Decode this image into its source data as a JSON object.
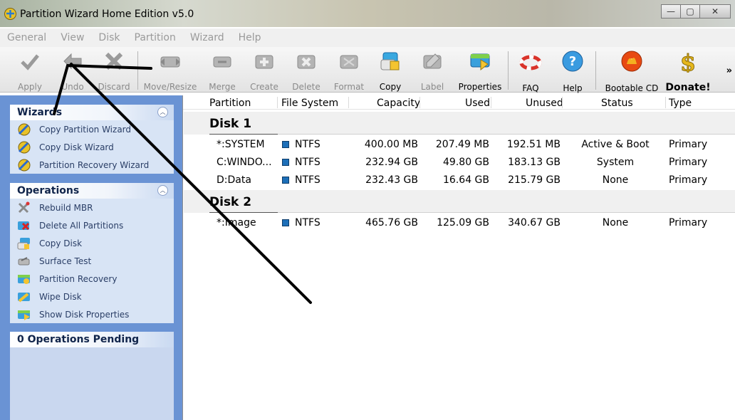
{
  "window": {
    "title": "Partition Wizard Home Edition v5.0",
    "minimize": "—",
    "maximize": "▢",
    "close": "✕"
  },
  "menu": [
    "General",
    "View",
    "Disk",
    "Partition",
    "Wizard",
    "Help"
  ],
  "toolbar": {
    "buttons": [
      {
        "label": "Apply",
        "icon": "check-icon",
        "enabled": false
      },
      {
        "label": "Undo",
        "icon": "undo-arrow-icon",
        "enabled": false
      },
      {
        "label": "Discard",
        "icon": "x-discard-icon",
        "enabled": false
      },
      {
        "label": "Move/Resize",
        "icon": "move-resize-icon",
        "enabled": false
      },
      {
        "label": "Merge",
        "icon": "merge-icon",
        "enabled": false
      },
      {
        "label": "Create",
        "icon": "create-icon",
        "enabled": false
      },
      {
        "label": "Delete",
        "icon": "delete-icon",
        "enabled": false
      },
      {
        "label": "Format",
        "icon": "format-icon",
        "enabled": false
      },
      {
        "label": "Copy",
        "icon": "copy-icon",
        "enabled": true
      },
      {
        "label": "Label",
        "icon": "label-icon",
        "enabled": false
      },
      {
        "label": "Properties",
        "icon": "properties-icon",
        "enabled": true
      },
      {
        "label": "FAQ",
        "icon": "lifebuoy-icon",
        "enabled": true
      },
      {
        "label": "Help",
        "icon": "help-icon",
        "enabled": true
      },
      {
        "label": "Bootable CD",
        "icon": "bootable-cd-icon",
        "enabled": true
      },
      {
        "label": "Donate!",
        "icon": "dollar-icon",
        "enabled": true
      }
    ],
    "more": "»"
  },
  "sidebar": {
    "wizards": {
      "title": "Wizards",
      "items": [
        "Copy Partition Wizard",
        "Copy Disk Wizard",
        "Partition Recovery Wizard"
      ]
    },
    "operations": {
      "title": "Operations",
      "items": [
        "Rebuild MBR",
        "Delete All Partitions",
        "Copy Disk",
        "Surface Test",
        "Partition Recovery",
        "Wipe Disk",
        "Show Disk Properties"
      ]
    },
    "pending": {
      "title": "0 Operations Pending"
    }
  },
  "table": {
    "columns": [
      "Partition",
      "File System",
      "Capacity",
      "Used",
      "Unused",
      "Status",
      "Type"
    ],
    "disks": [
      {
        "name": "Disk 1",
        "rows": [
          [
            "*:SYSTEM",
            "NTFS",
            "400.00 MB",
            "207.49 MB",
            "192.51 MB",
            "Active & Boot",
            "Primary"
          ],
          [
            "C:WINDO...",
            "NTFS",
            "232.94 GB",
            "49.80 GB",
            "183.13 GB",
            "System",
            "Primary"
          ],
          [
            "D:Data",
            "NTFS",
            "232.43 GB",
            "16.64 GB",
            "215.79 GB",
            "None",
            "Primary"
          ]
        ]
      },
      {
        "name": "Disk 2",
        "rows": [
          [
            "*:Image",
            "NTFS",
            "465.76 GB",
            "125.09 GB",
            "340.67 GB",
            "None",
            "Primary"
          ]
        ]
      }
    ]
  },
  "colors": {
    "sidebar": "#6a93d4",
    "panel": "#d8e4f5",
    "fs_marker": "#1d6fb8"
  }
}
